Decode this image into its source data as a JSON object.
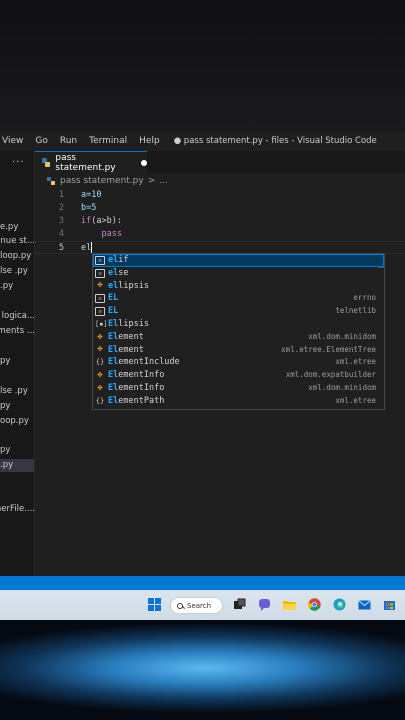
{
  "menubar": {
    "items": [
      "View",
      "Go",
      "Run",
      "Terminal",
      "Help"
    ],
    "window_title": "● pass statement.py - files - Visual Studio Code"
  },
  "sidebar": {
    "dots": "···",
    "items": [
      {
        "label": "e.py",
        "active": false
      },
      {
        "label": "tinue st...",
        "active": false
      },
      {
        "label": "loop.py",
        "active": false
      },
      {
        "label": "lse .py",
        "active": false
      },
      {
        "label": ".py",
        "active": false
      },
      {
        "label": "n logica...",
        "active": false
      },
      {
        "label": "ments ...",
        "active": false
      },
      {
        "label": "py",
        "active": false
      },
      {
        "label": "lse .py",
        "active": false
      },
      {
        "label": "py",
        "active": false
      },
      {
        "label": "oop.py",
        "active": false
      },
      {
        "label": "py",
        "active": false
      },
      {
        "label": ".py",
        "active": true
      },
      {
        "label": "nerFile....",
        "active": false
      }
    ]
  },
  "tab": {
    "label": "pass statement.py",
    "modified": true
  },
  "breadcrumb": {
    "file": "pass statement.py",
    "sep": ">",
    "more": "..."
  },
  "code": {
    "lines": [
      {
        "num": "1",
        "text": "a=10"
      },
      {
        "num": "2",
        "text": "b=5"
      },
      {
        "num": "3",
        "text": "if(a>b):"
      },
      {
        "num": "4",
        "text": "    pass"
      },
      {
        "num": "5",
        "text": "el"
      }
    ]
  },
  "suggestions": [
    {
      "icon": "keyword-icon",
      "label": "elif",
      "detail": "",
      "selected": true
    },
    {
      "icon": "keyword-icon",
      "label": "else",
      "detail": "",
      "selected": false
    },
    {
      "icon": "class-icon",
      "label": "ellipsis",
      "detail": "",
      "selected": false
    },
    {
      "icon": "keyword-icon",
      "label": "EL",
      "detail": "errno",
      "selected": false
    },
    {
      "icon": "keyword-icon",
      "label": "EL",
      "detail": "telnetlib",
      "selected": false
    },
    {
      "icon": "variable-icon",
      "label": "Ellipsis",
      "detail": "",
      "selected": false
    },
    {
      "icon": "class-icon",
      "label": "Element",
      "detail": "xml.dom.minidom",
      "selected": false
    },
    {
      "icon": "class-icon",
      "label": "Element",
      "detail": "xml.etree.ElementTree",
      "selected": false
    },
    {
      "icon": "module-icon",
      "label": "ElementInclude",
      "detail": "xml.etree",
      "selected": false
    },
    {
      "icon": "class-icon",
      "label": "ElementInfo",
      "detail": "xml.dom.expatbuilder",
      "selected": false
    },
    {
      "icon": "class-icon",
      "label": "ElementInfo",
      "detail": "xml.dom.minidom",
      "selected": false
    },
    {
      "icon": "module-icon",
      "label": "ElementPath",
      "detail": "xml.etree",
      "selected": false
    }
  ],
  "taskbar": {
    "search_label": "Search",
    "icons": [
      "windows-start-icon",
      "task-view-icon",
      "chat-icon",
      "file-explorer-icon",
      "chrome-icon",
      "edge-icon",
      "mail-icon",
      "store-icon"
    ]
  },
  "colors": {
    "accent": "#0078d4",
    "match": "#2aaaff"
  }
}
